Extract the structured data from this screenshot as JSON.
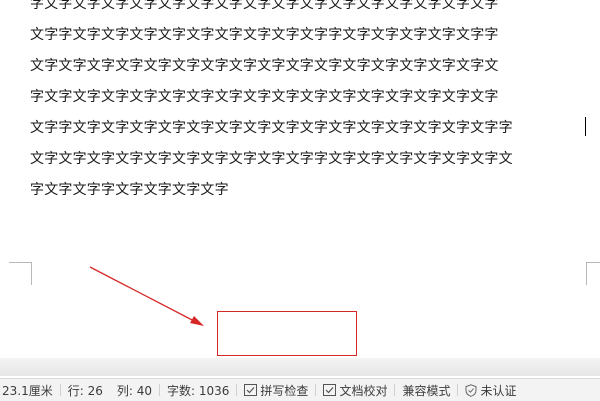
{
  "document": {
    "lines": [
      "字文字文字文字文字文字文字文字文字文字文字文字文字文字文字文字文字",
      "文字字文字文字文字文字文字文字文字文字文字字文字文字文字文字文字字",
      "文字文字文字文字文字文字文字文字文字文字文字文字文字文字文字文字文",
      "字文字文字文字文字文字文字文字文字文字文字文字文字文字文字文字文字",
      "文字字文字文字文字文字文字文字文字文字文字文字文字文字文字文字文字字",
      "文字文字文字文字文字文字文字文字文字文字字文字文字文字文字文字文字文",
      "字文字文字字文字文字文字文字"
    ]
  },
  "statusbar": {
    "position": "23.1厘米",
    "row": "行: 26",
    "column": "列: 40",
    "word_count": "字数: 1036",
    "spell_check": "拼写检查",
    "proofread": "文档校对",
    "compat_mode": "兼容模式",
    "certification": "未认证"
  },
  "colors": {
    "annotation": "#d62727",
    "statusbar_bg": "#f3f3f3"
  }
}
